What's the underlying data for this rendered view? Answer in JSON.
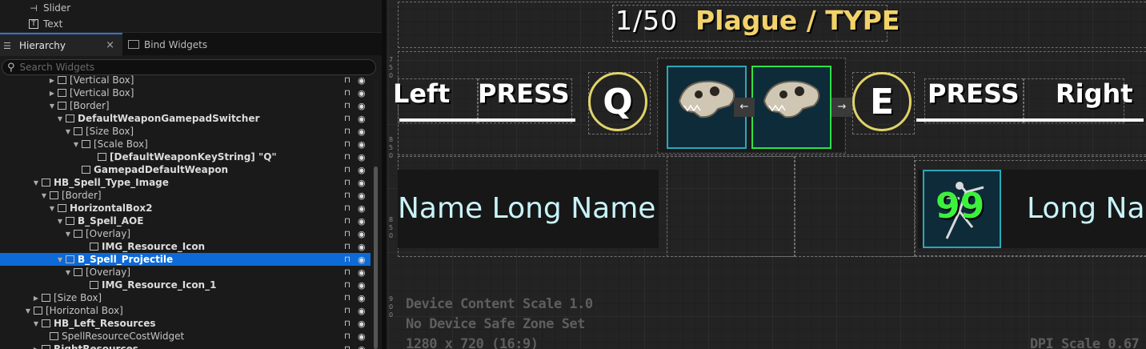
{
  "palette": {
    "items": [
      {
        "icon": "slider-icon",
        "glyph": "+",
        "label": "Slider"
      },
      {
        "icon": "text-icon",
        "glyph": "T",
        "label": "Text"
      }
    ]
  },
  "tabs": {
    "hierarchy": "Hierarchy",
    "bind_widgets": "Bind Widgets",
    "close": "×"
  },
  "search": {
    "placeholder": "Search Widgets"
  },
  "tree": [
    {
      "label": "[Vertical Box]",
      "indent": 6,
      "arrow": "▶",
      "bold": false
    },
    {
      "label": "[Vertical Box]",
      "indent": 6,
      "arrow": "▶",
      "bold": false
    },
    {
      "label": "[Border]",
      "indent": 6,
      "arrow": "▼",
      "bold": false
    },
    {
      "label": "DefaultWeaponGamepadSwitcher",
      "indent": 7,
      "arrow": "▼",
      "bold": true
    },
    {
      "label": "[Size Box]",
      "indent": 8,
      "arrow": "▼",
      "bold": false
    },
    {
      "label": "[Scale Box]",
      "indent": 9,
      "arrow": "▼",
      "bold": false
    },
    {
      "label": "[DefaultWeaponKeyString] \"Q\"",
      "indent": 11,
      "arrow": "",
      "bold": true
    },
    {
      "label": "GamepadDefaultWeapon",
      "indent": 9,
      "arrow": "",
      "bold": true
    },
    {
      "label": "HB_Spell_Type_Image",
      "indent": 4,
      "arrow": "▼",
      "bold": true
    },
    {
      "label": "[Border]",
      "indent": 5,
      "arrow": "▼",
      "bold": false
    },
    {
      "label": "HorizontalBox2",
      "indent": 6,
      "arrow": "▼",
      "bold": true
    },
    {
      "label": "B_Spell_AOE",
      "indent": 7,
      "arrow": "▼",
      "bold": true
    },
    {
      "label": "[Overlay]",
      "indent": 8,
      "arrow": "▼",
      "bold": false
    },
    {
      "label": "IMG_Resource_Icon",
      "indent": 10,
      "arrow": "",
      "bold": true
    },
    {
      "label": "B_Spell_Projectile",
      "indent": 7,
      "arrow": "▼",
      "bold": true,
      "selected": true
    },
    {
      "label": "[Overlay]",
      "indent": 8,
      "arrow": "▼",
      "bold": false
    },
    {
      "label": "IMG_Resource_Icon_1",
      "indent": 10,
      "arrow": "",
      "bold": true
    },
    {
      "label": "[Size Box]",
      "indent": 4,
      "arrow": "▶",
      "bold": false
    },
    {
      "label": "[Horizontal Box]",
      "indent": 3,
      "arrow": "▼",
      "bold": false
    },
    {
      "label": "HB_Left_Resources",
      "indent": 4,
      "arrow": "▼",
      "bold": true
    },
    {
      "label": "SpellResourceCostWidget",
      "indent": 5,
      "arrow": "",
      "bold": false
    },
    {
      "label": "RightResources",
      "indent": 4,
      "arrow": "▶",
      "bold": true
    }
  ],
  "canvas": {
    "counter": "1/50",
    "type_label": "Plague / TYPE",
    "left_label": "Left",
    "press_left": "PRESS",
    "key_left": "Q",
    "key_right": "E",
    "press_right": "PRESS",
    "right_label": "Right",
    "arrow_left": "←",
    "arrow_right": "→",
    "name_left": "Name Long Name",
    "name_right": "Long Na",
    "count": "99",
    "info_lines": [
      "Device Content Scale 1.0",
      "No Device Safe Zone Set",
      "1280 x 720 (16:9)"
    ],
    "dpi": "DPI Scale 0.67",
    "ruler_a": [
      "7",
      "5",
      "0"
    ],
    "ruler_b": [
      "8",
      "5",
      "0"
    ],
    "ruler_c": [
      "8",
      "5",
      "0"
    ],
    "ruler_d": [
      "9",
      "0",
      "0"
    ],
    "colors": {
      "title_yellow": "#f2d26a",
      "cyan_text": "#c8f3f8",
      "green_count": "#3cf03c",
      "ring": "#e1d36a",
      "selection": "#0e6ad7"
    }
  }
}
